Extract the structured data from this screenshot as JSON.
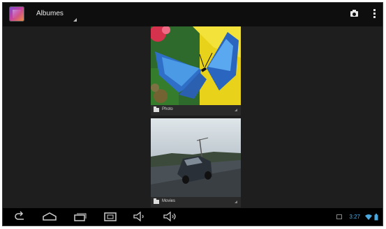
{
  "actionbar": {
    "app_icon": "gallery-icon",
    "title": "Albumes",
    "actions": [
      "camera-icon",
      "overflow-menu-icon"
    ]
  },
  "albums": [
    {
      "label": "Photo",
      "icon": "folder-icon",
      "thumbnail": "butterfly-photo"
    },
    {
      "label": "Movies",
      "icon": "folder-icon",
      "thumbnail": "car-road-photo"
    }
  ],
  "navbar": {
    "buttons": [
      "back-icon",
      "home-icon",
      "recent-apps-icon",
      "screenshot-icon",
      "volume-down-icon",
      "volume-up-icon"
    ]
  },
  "status": {
    "time": "3:27",
    "icons": [
      "notification-icon",
      "wifi-icon",
      "battery-icon"
    ],
    "accent_color": "#4aa8e0"
  }
}
